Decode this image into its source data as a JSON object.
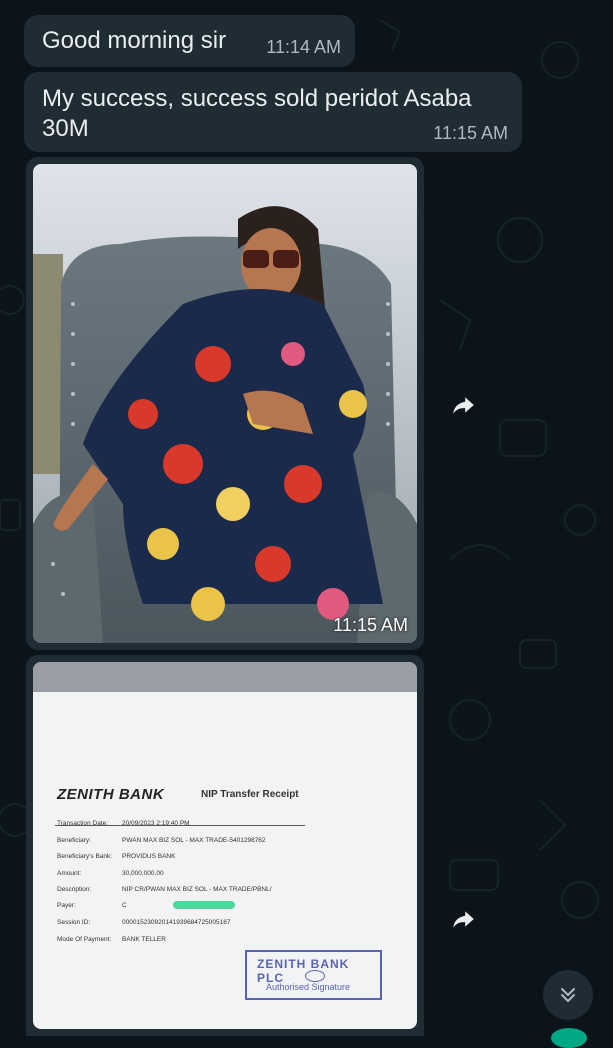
{
  "messages": [
    {
      "text": "Good morning sir",
      "time": "11:14 AM"
    },
    {
      "text": "My success, success sold peridot Asaba 30M",
      "time": "11:15 AM"
    }
  ],
  "photo_message": {
    "time": "11:15 AM"
  },
  "receipt": {
    "bank_name": "ZENITH BANK",
    "title": "NIP Transfer Receipt",
    "rows": [
      {
        "label": "Transaction Date:",
        "value": "20/09/2023 2:19:40 PM"
      },
      {
        "label": "Beneficiary:",
        "value": "PWAN MAX BIZ SOL - MAX TRADE-5401298762"
      },
      {
        "label": "Beneficiary's Bank:",
        "value": "PROVIDUS BANK"
      },
      {
        "label": "Amount:",
        "value": "30,000,000.00"
      },
      {
        "label": "Description:",
        "value": "NIP CR/PWAN MAX BIZ SOL - MAX TRADE/PBNL/"
      },
      {
        "label": "Payer:",
        "value": "C"
      },
      {
        "label": "Session ID:",
        "value": "000015230920141939684725005167"
      },
      {
        "label": "Mode Of Payment:",
        "value": "BANK TELLER"
      }
    ],
    "stamp_text": "ZENITH BANK PLC",
    "stamp_caption": "Authorised Signature"
  },
  "icons": {
    "forward": "forward-arrow-icon",
    "scroll_down": "double-chevron-down-icon"
  },
  "colors": {
    "background": "#0b141a",
    "bubble": "#1f2c34",
    "text": "#e9edef",
    "timestamp": "#aebac1",
    "accent": "#00a884"
  }
}
